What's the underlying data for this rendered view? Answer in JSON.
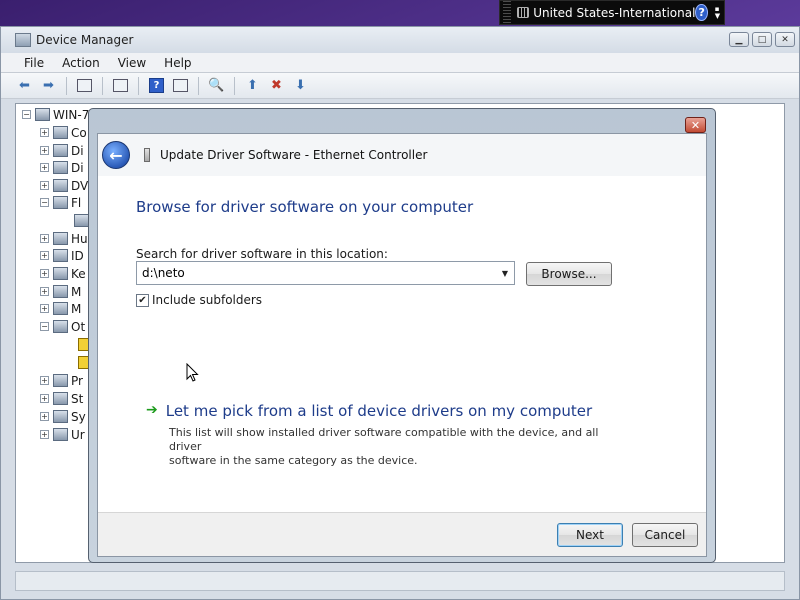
{
  "language_bar": {
    "label": "United States-International",
    "help": "?"
  },
  "device_manager": {
    "title": "Device Manager",
    "menu": [
      "File",
      "Action",
      "View",
      "Help"
    ],
    "tree": {
      "root": "WIN-7",
      "items": [
        {
          "label": "Co",
          "expanded": false
        },
        {
          "label": "Di",
          "expanded": false
        },
        {
          "label": "Di",
          "expanded": false
        },
        {
          "label": "DV",
          "expanded": false
        },
        {
          "label": "Fl",
          "expanded": true
        },
        {
          "label": "",
          "expanded": false,
          "child": true
        },
        {
          "label": "Hu",
          "expanded": false
        },
        {
          "label": "ID",
          "expanded": false
        },
        {
          "label": "Ke",
          "expanded": false
        },
        {
          "label": "M",
          "expanded": false
        },
        {
          "label": "M",
          "expanded": false
        },
        {
          "label": "Ot",
          "expanded": true
        },
        {
          "label": "",
          "child": true,
          "warning": true
        },
        {
          "label": "",
          "child": true,
          "warning": true
        },
        {
          "label": "Pr",
          "expanded": false
        },
        {
          "label": "St",
          "expanded": false
        },
        {
          "label": "Sy",
          "expanded": false
        },
        {
          "label": "Ur",
          "expanded": false
        }
      ]
    }
  },
  "dialog": {
    "title": "Update Driver Software - Ethernet Controller",
    "heading": "Browse for driver software on your computer",
    "location_label": "Search for driver software in this location:",
    "location_value": "d:\\neto",
    "browse_label": "Browse...",
    "include_subfolders_label": "Include subfolders",
    "include_subfolders_checked": true,
    "pick_title": "Let me pick from a list of device drivers on my computer",
    "pick_desc_line1": "This list will show installed driver software compatible with the device, and all driver",
    "pick_desc_line2": "software in the same category as the device.",
    "next_label": "Next",
    "cancel_label": "Cancel"
  }
}
